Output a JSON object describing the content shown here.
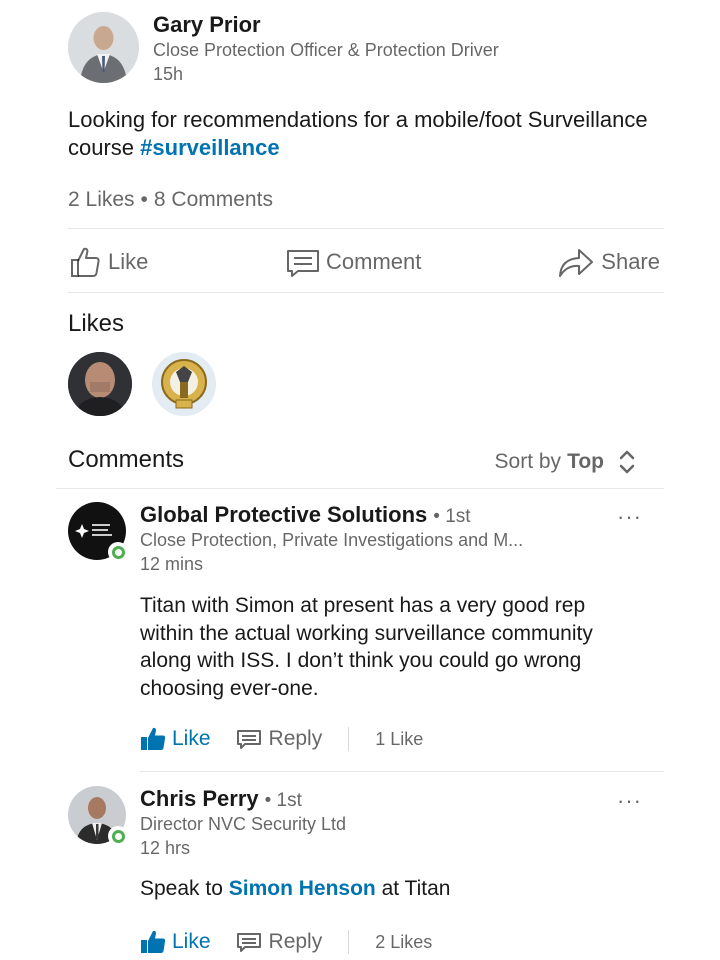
{
  "post": {
    "author_name": "Gary Prior",
    "author_headline": "Close Protection Officer & Protection Driver",
    "time": "15h",
    "text": "Looking for recommendations for a mobile/foot Surveillance course ",
    "hashtag": "#surveillance",
    "likes_count": "2 Likes",
    "separator": "•",
    "comments_count": "8 Comments"
  },
  "actions": {
    "like": "Like",
    "comment": "Comment",
    "share": "Share"
  },
  "likes_section": {
    "title": "Likes"
  },
  "comments_section": {
    "title": "Comments",
    "sort_label": "Sort by",
    "sort_value": "Top"
  },
  "comments": [
    {
      "name": "Global Protective Solutions",
      "degree": "• 1st",
      "headline": "Close Protection, Private Investigations and M...",
      "time": "12 mins",
      "text": "Titan with Simon at present has a very good rep within the actual working surveillance community along with ISS. I don’t think you could go wrong choosing ever-one.",
      "like_label": "Like",
      "reply_label": "Reply",
      "likes": "1 Like",
      "more": "···"
    },
    {
      "name": "Chris Perry",
      "degree": "• 1st",
      "headline": "Director NVC Security Ltd",
      "time": "12 hrs",
      "text_before": "Speak to ",
      "mention": "Simon Henson",
      "text_after": " at Titan",
      "like_label": "Like",
      "reply_label": "Reply",
      "likes": "2 Likes",
      "more": "···"
    }
  ],
  "colors": {
    "link_blue": "#0073b1",
    "online_green": "#4caf50",
    "secondary_text": "rgba(0,0,0,0.6)",
    "divider": "#e6e9ec"
  }
}
